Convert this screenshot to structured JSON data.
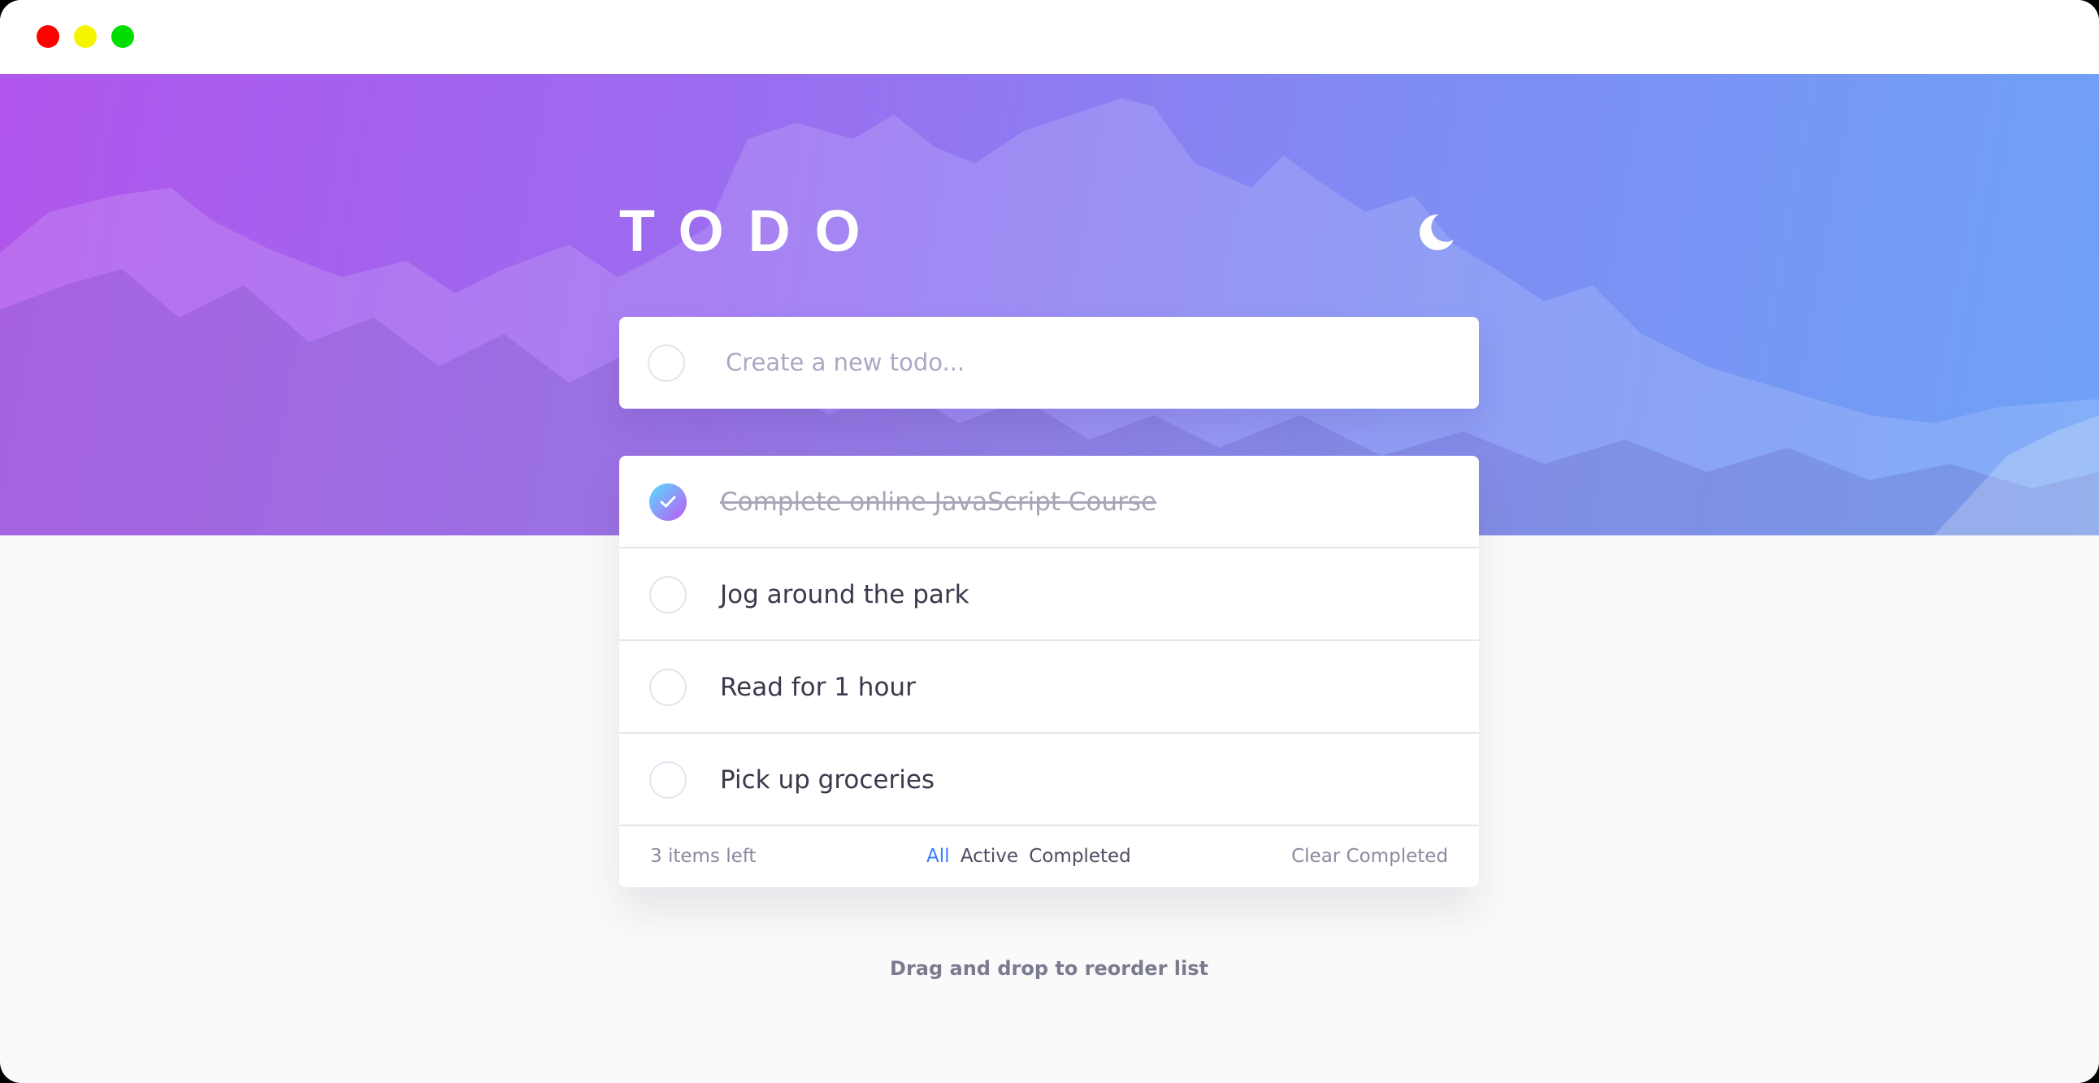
{
  "window": {
    "controls": [
      "close",
      "minimize",
      "maximize"
    ]
  },
  "app": {
    "title": "TODO",
    "theme_toggle_icon": "moon-icon"
  },
  "new_todo": {
    "placeholder": "Create a new todo..."
  },
  "todos": [
    {
      "text": "Complete online JavaScript Course",
      "completed": true
    },
    {
      "text": "Jog around the park",
      "completed": false
    },
    {
      "text": "Read for 1 hour",
      "completed": false
    },
    {
      "text": "Pick up groceries",
      "completed": false
    }
  ],
  "footer": {
    "items_left": "3 items left",
    "filters": {
      "all": "All",
      "active": "Active",
      "completed": "Completed"
    },
    "active_filter": "All",
    "clear": "Clear Completed"
  },
  "hint": "Drag and drop to reorder list",
  "colors": {
    "accent": "#3a7cfd",
    "gradient_start": "#55ddff",
    "gradient_end": "#c058f3",
    "hero_start": "#b056ec",
    "hero_end": "#6fa2f6"
  }
}
